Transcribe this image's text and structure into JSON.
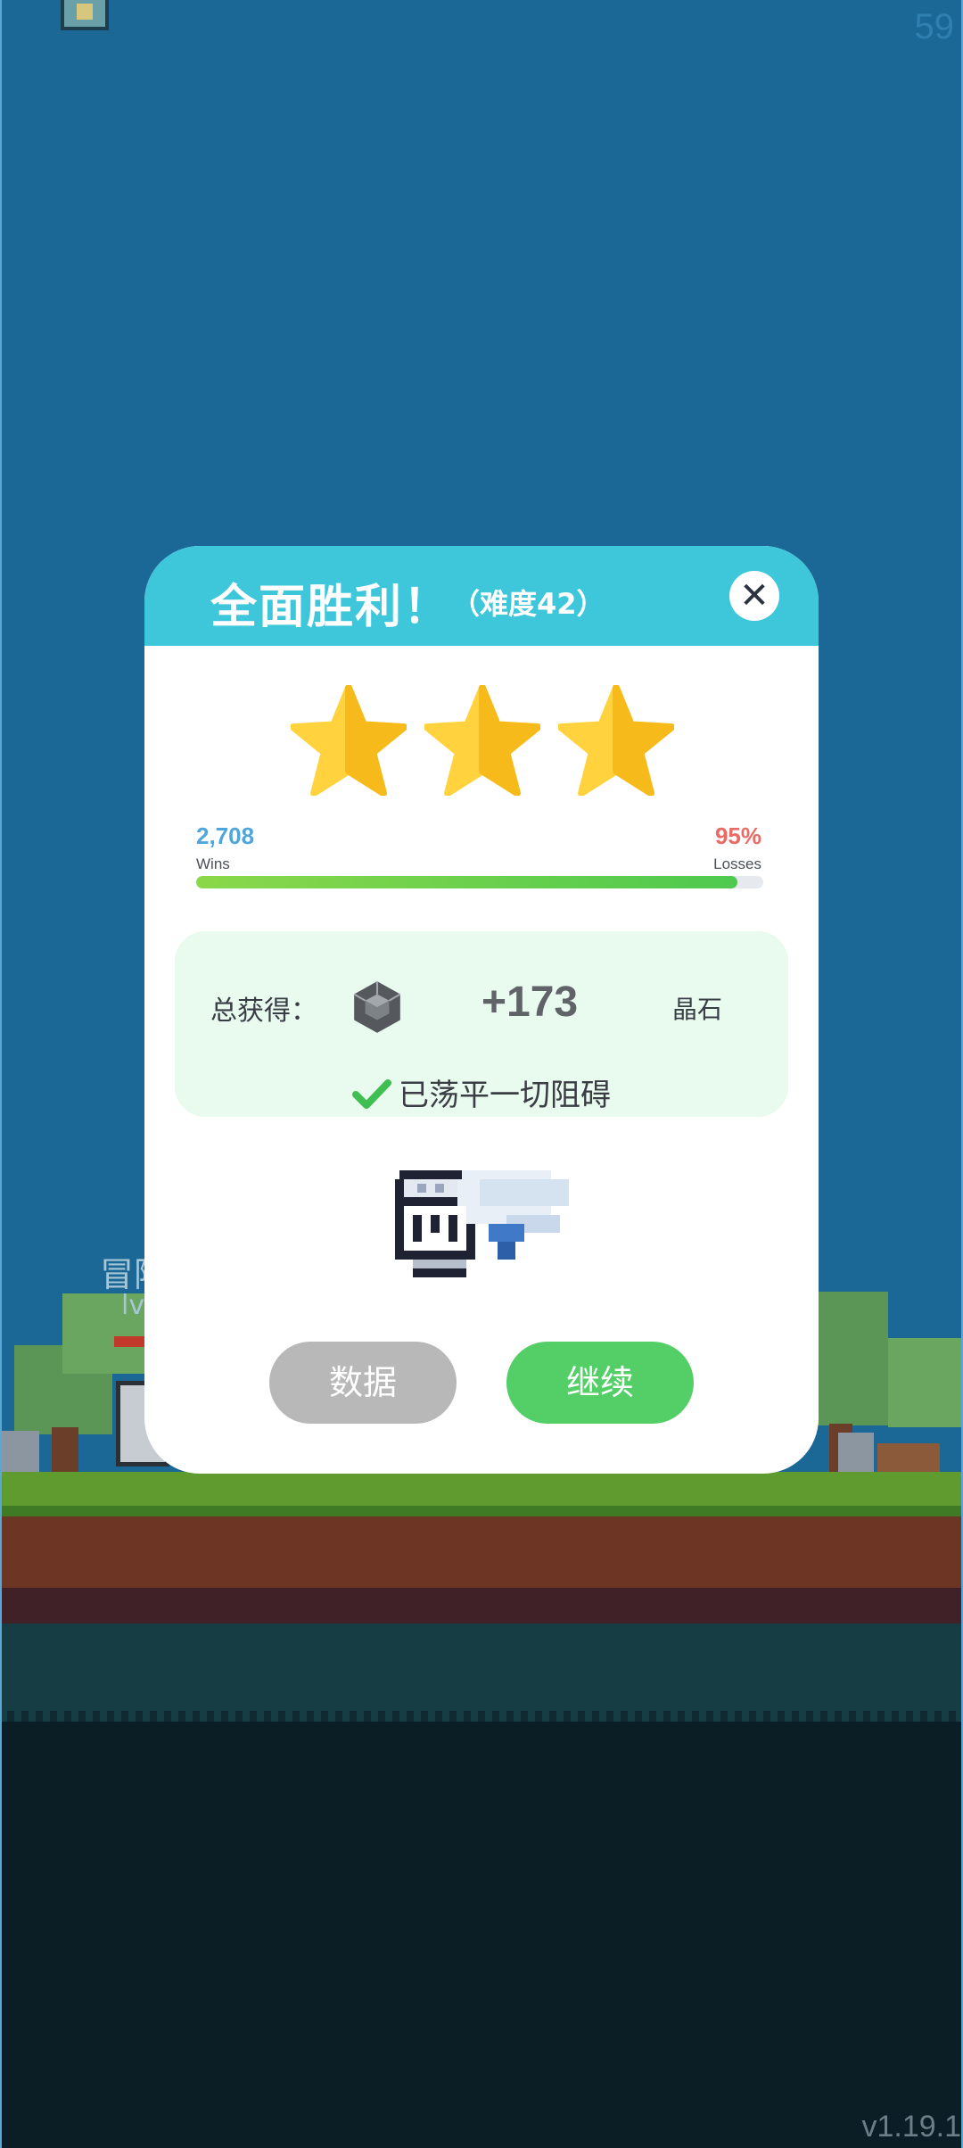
{
  "hud": {
    "fps": "59",
    "version": "v1.19.1"
  },
  "scene": {
    "npc_name_partial": "冒险",
    "npc_level_partial": "lv"
  },
  "dialog": {
    "title": "全面胜利！",
    "subtitle": "（难度42）",
    "close_icon": "close-icon",
    "stars_earned": 3,
    "stars_total": 3,
    "stats": {
      "wins_value": "2,708",
      "wins_label": "Wins",
      "losses_value": "95%",
      "losses_label": "Losses",
      "progress_fraction": 0.955
    },
    "reward": {
      "label": "总获得：",
      "icon": "crystal-gem-icon",
      "amount": "+173",
      "unit": "晶石",
      "message": "已荡平一切阻碍"
    },
    "item_icon": "winged-gauntlet-icon",
    "buttons": {
      "data_label": "数据",
      "continue_label": "继续"
    }
  },
  "colors": {
    "header": "#3ec6da",
    "star": "#ffc928",
    "continue": "#54cf68",
    "data_button": "#b8b8b8",
    "wins": "#4fa6dc",
    "losses": "#e86b66"
  }
}
